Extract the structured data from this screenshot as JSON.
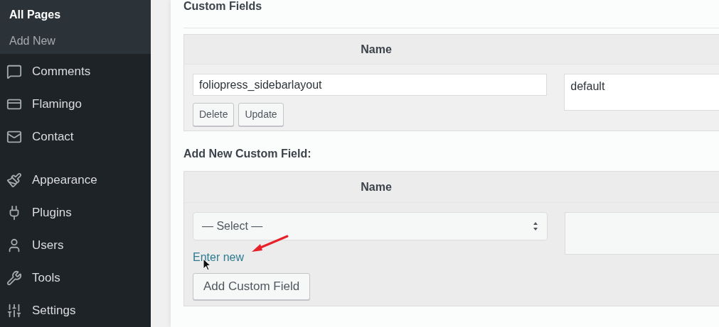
{
  "sidebar": {
    "submenu": [
      {
        "label": "All Pages",
        "selected": true
      },
      {
        "label": "Add New",
        "selected": false
      }
    ],
    "items": [
      {
        "label": "Comments"
      },
      {
        "label": "Flamingo"
      },
      {
        "label": "Contact"
      },
      {
        "label": "Appearance",
        "group_start": true
      },
      {
        "label": "Plugins"
      },
      {
        "label": "Users"
      },
      {
        "label": "Tools"
      },
      {
        "label": "Settings"
      }
    ]
  },
  "custom_fields": {
    "title": "Custom Fields",
    "header": "Name",
    "rows": [
      {
        "name": "foliopress_sidebarlayout",
        "value": "default",
        "buttons": [
          "Delete",
          "Update"
        ]
      }
    ]
  },
  "add_new": {
    "title": "Add New Custom Field:",
    "header": "Name",
    "select": "— Select —",
    "link": "Enter new",
    "button": "Add Custom Field"
  }
}
